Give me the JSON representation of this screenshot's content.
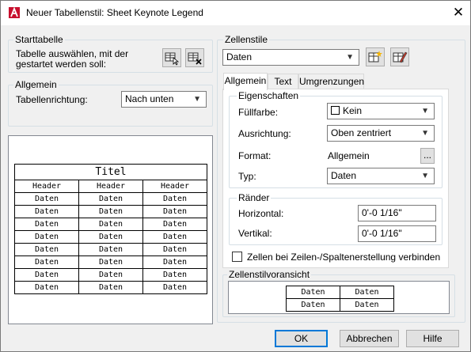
{
  "window": {
    "title": "Neuer Tabellenstil: Sheet Keynote Legend",
    "close_glyph": "✕"
  },
  "starttabelle": {
    "group_label": "Starttabelle",
    "label_line1": "Tabelle auswählen, mit der",
    "label_line2": "gestartet werden soll:"
  },
  "allgemein_group": {
    "group_label": "Allgemein",
    "direction_label": "Tabellenrichtung:",
    "direction_value": "Nach unten"
  },
  "preview": {
    "title": "Titel",
    "headers": [
      "Header",
      "Header",
      "Header"
    ],
    "row_value": "Daten",
    "row_count": 8
  },
  "zellenstile": {
    "group_label": "Zellenstile",
    "selected": "Daten"
  },
  "tabs": [
    "Allgemein",
    "Text",
    "Umgrenzungen"
  ],
  "eigenschaften": {
    "group_label": "Eigenschaften",
    "fill_label": "Füllfarbe:",
    "fill_value": "Kein",
    "align_label": "Ausrichtung:",
    "align_value": "Oben zentriert",
    "format_label": "Format:",
    "format_value": "Allgemein",
    "format_button": "...",
    "type_label": "Typ:",
    "type_value": "Daten"
  },
  "raender": {
    "group_label": "Ränder",
    "horizontal_label": "Horizontal:",
    "horizontal_value": "0'-0 1/16\"",
    "vertical_label": "Vertikal:",
    "vertical_value": "0'-0 1/16\""
  },
  "merge_checkbox_label": "Zellen bei Zeilen-/Spaltenerstellung verbinden",
  "cellstyle_preview": {
    "group_label": "Zellenstilvoransicht",
    "cells": [
      "Daten",
      "Daten",
      "Daten",
      "Daten"
    ]
  },
  "buttons": {
    "ok": "OK",
    "cancel": "Abbrechen",
    "help": "Hilfe"
  },
  "colors": {
    "accent": "#0078d7",
    "logo_red": "#c8102e"
  }
}
